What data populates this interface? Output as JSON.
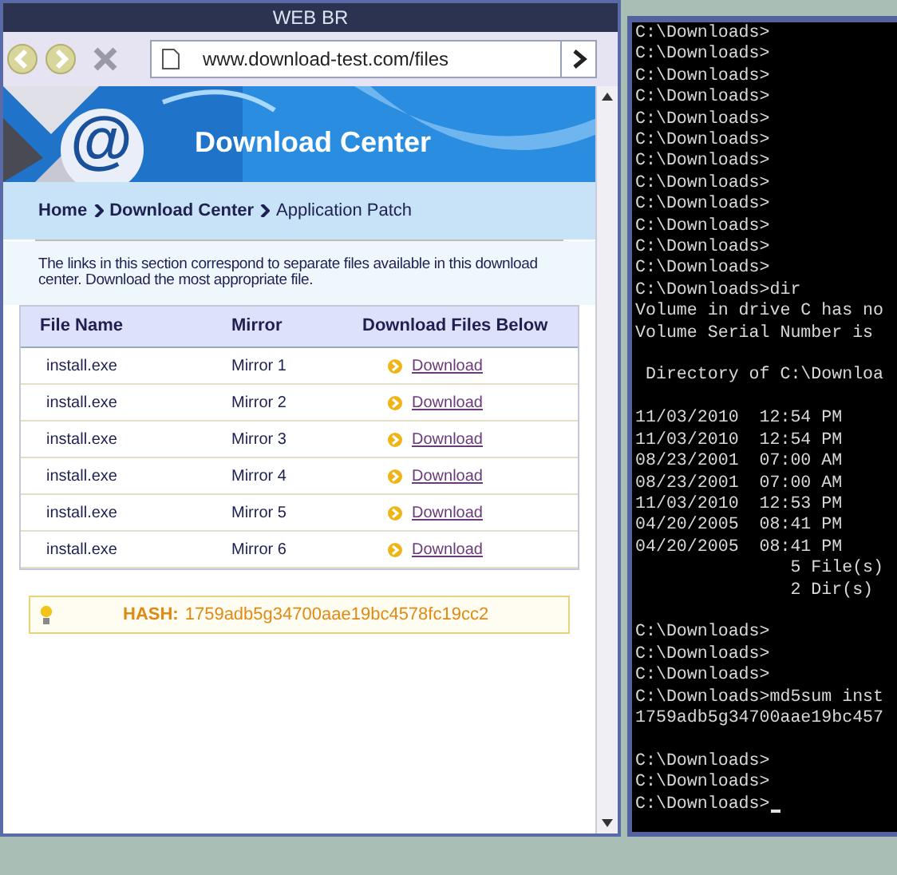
{
  "browser": {
    "title": "WEB BR",
    "address": "www.download-test.com/files"
  },
  "banner": {
    "glyph": "@",
    "title": "Download Center"
  },
  "breadcrumb": [
    {
      "label": "Home",
      "current": false
    },
    {
      "label": "Download Center",
      "current": false
    },
    {
      "label": "Application Patch",
      "current": true
    }
  ],
  "description": "The links in this section correspond to separate files available in this download center. Download the most appropriate file.",
  "table": {
    "columns": [
      "File Name",
      "Mirror",
      "Download Files Below"
    ],
    "rows": [
      {
        "file": "install.exe",
        "mirror": "Mirror 1",
        "link": "Download"
      },
      {
        "file": "install.exe",
        "mirror": "Mirror 2",
        "link": "Download"
      },
      {
        "file": "install.exe",
        "mirror": "Mirror 3",
        "link": "Download"
      },
      {
        "file": "install.exe",
        "mirror": "Mirror 4",
        "link": "Download"
      },
      {
        "file": "install.exe",
        "mirror": "Mirror 5",
        "link": "Download"
      },
      {
        "file": "install.exe",
        "mirror": "Mirror 6",
        "link": "Download"
      }
    ]
  },
  "hash": {
    "label": "HASH:",
    "value": "1759adb5g34700aae19bc4578fc19cc2"
  },
  "terminal": {
    "cursor": true,
    "blocks": [
      [
        "C:\\Downloads>",
        "C:\\Downloads>",
        "C:\\Downloads>",
        "C:\\Downloads>",
        "C:\\Downloads>",
        "C:\\Downloads>",
        "C:\\Downloads>",
        "C:\\Downloads>",
        "C:\\Downloads>",
        "C:\\Downloads>",
        "C:\\Downloads>",
        "C:\\Downloads>",
        "C:\\Downloads>dir",
        "Volume in drive C has no",
        "Volume Serial Number is"
      ],
      [
        " Directory of C:\\Downloa"
      ],
      [
        "11/03/2010  12:54 PM",
        "11/03/2010  12:54 PM",
        "08/23/2001  07:00 AM",
        "08/23/2001  07:00 AM",
        "11/03/2010  12:53 PM",
        "04/20/2005  08:41 PM",
        "04/20/2005  08:41 PM",
        "               5 File(s)",
        "               2 Dir(s)"
      ],
      [
        "C:\\Downloads>",
        "C:\\Downloads>",
        "C:\\Downloads>",
        "C:\\Downloads>md5sum inst",
        "1759adb5g34700aae19bc457"
      ],
      [
        "C:\\Downloads>",
        "C:\\Downloads>",
        "C:\\Downloads>"
      ]
    ]
  }
}
